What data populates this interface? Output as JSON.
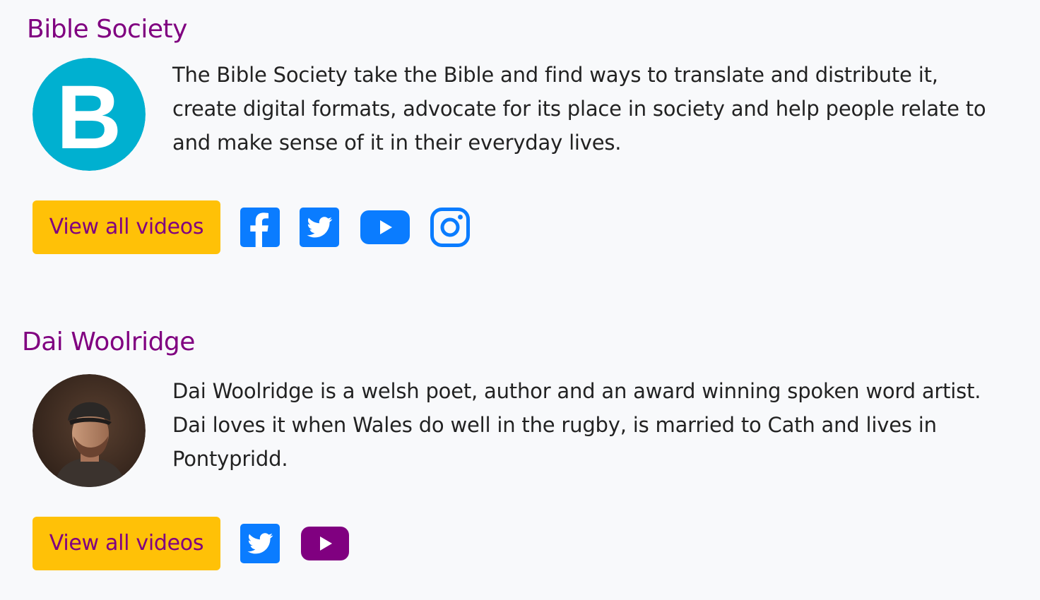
{
  "profiles": [
    {
      "name": "Bible Society",
      "logo_letter": "B",
      "logo_color": "#00b0d0",
      "bio": "The Bible Society take the Bible and find ways to translate and distribute it, create digital formats, advocate for its place in society and help people relate to and make sense of it in their everyday lives.",
      "button_label": "View all videos",
      "socials": [
        "facebook-icon",
        "twitter-icon",
        "youtube-icon",
        "instagram-icon"
      ]
    },
    {
      "name": "Dai Woolridge",
      "bio": "Dai Woolridge is a welsh poet, author and an award winning spoken word artist. Dai loves it when Wales do well in the rugby, is married to Cath and lives in Pontypridd.",
      "button_label": "View all videos",
      "socials": [
        "twitter-icon",
        "youtube-icon"
      ]
    }
  ],
  "colors": {
    "heading": "#800080",
    "button_bg": "#ffc107",
    "social_blue": "#0a7cff",
    "social_purple": "#800080",
    "background": "#f8f9fb"
  }
}
